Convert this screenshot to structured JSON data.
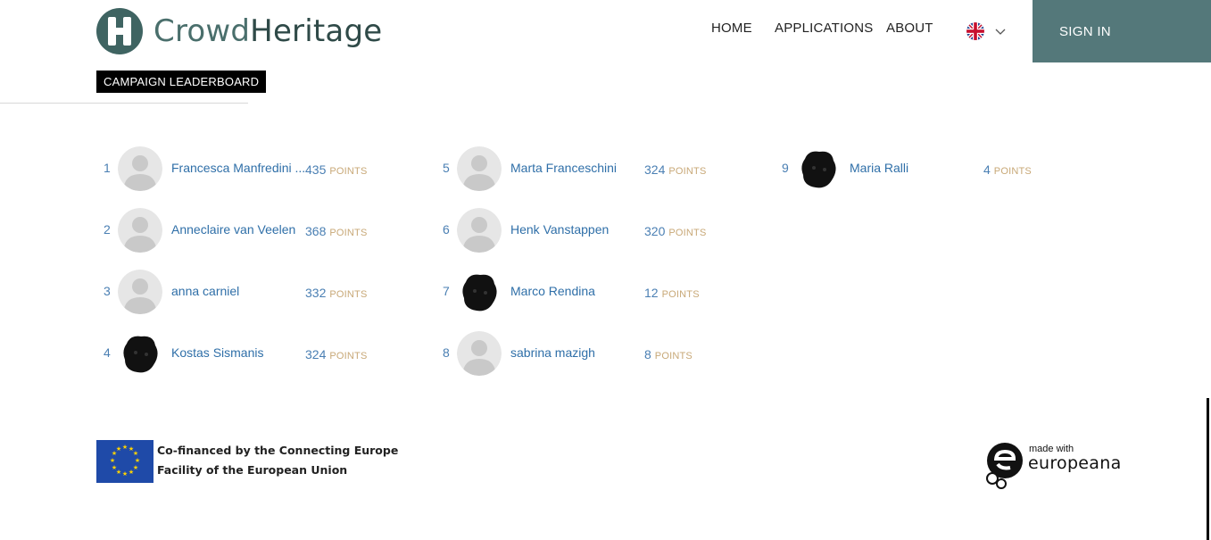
{
  "brand": {
    "name_part1": "Crowd",
    "name_part2": "Heritage"
  },
  "nav": {
    "home": "HOME",
    "applications": "APPLICATIONS",
    "about": "ABOUT",
    "language_icon": "uk-flag-icon",
    "sign_in": "SIGN IN"
  },
  "page": {
    "badge": "CAMPAIGN LEADERBOARD"
  },
  "leaderboard": {
    "points_label": "POINTS",
    "entries": [
      {
        "rank": "1",
        "name": "Francesca Manfredini ...",
        "points": "435",
        "avatar": "default"
      },
      {
        "rank": "2",
        "name": "Anneclaire van Veelen",
        "points": "368",
        "avatar": "default"
      },
      {
        "rank": "3",
        "name": "anna carniel",
        "points": "332",
        "avatar": "default"
      },
      {
        "rank": "4",
        "name": "Kostas Sismanis",
        "points": "324",
        "avatar": "redacted"
      },
      {
        "rank": "5",
        "name": "Marta Franceschini",
        "points": "324",
        "avatar": "default"
      },
      {
        "rank": "6",
        "name": "Henk Vanstappen",
        "points": "320",
        "avatar": "default"
      },
      {
        "rank": "7",
        "name": "Marco Rendina",
        "points": "12",
        "avatar": "redacted"
      },
      {
        "rank": "8",
        "name": "sabrina mazigh",
        "points": "8",
        "avatar": "default"
      },
      {
        "rank": "9",
        "name": "Maria Ralli",
        "points": "4",
        "avatar": "redacted"
      }
    ]
  },
  "footer": {
    "eu_line1": "Co-financed by the Connecting Europe",
    "eu_line2": "Facility of the European Union",
    "europeana_small": "made with",
    "europeana_word": "europeana"
  },
  "colors": {
    "brand": "#54787a",
    "link": "#2f6fa8",
    "points_label": "#c8a877"
  }
}
